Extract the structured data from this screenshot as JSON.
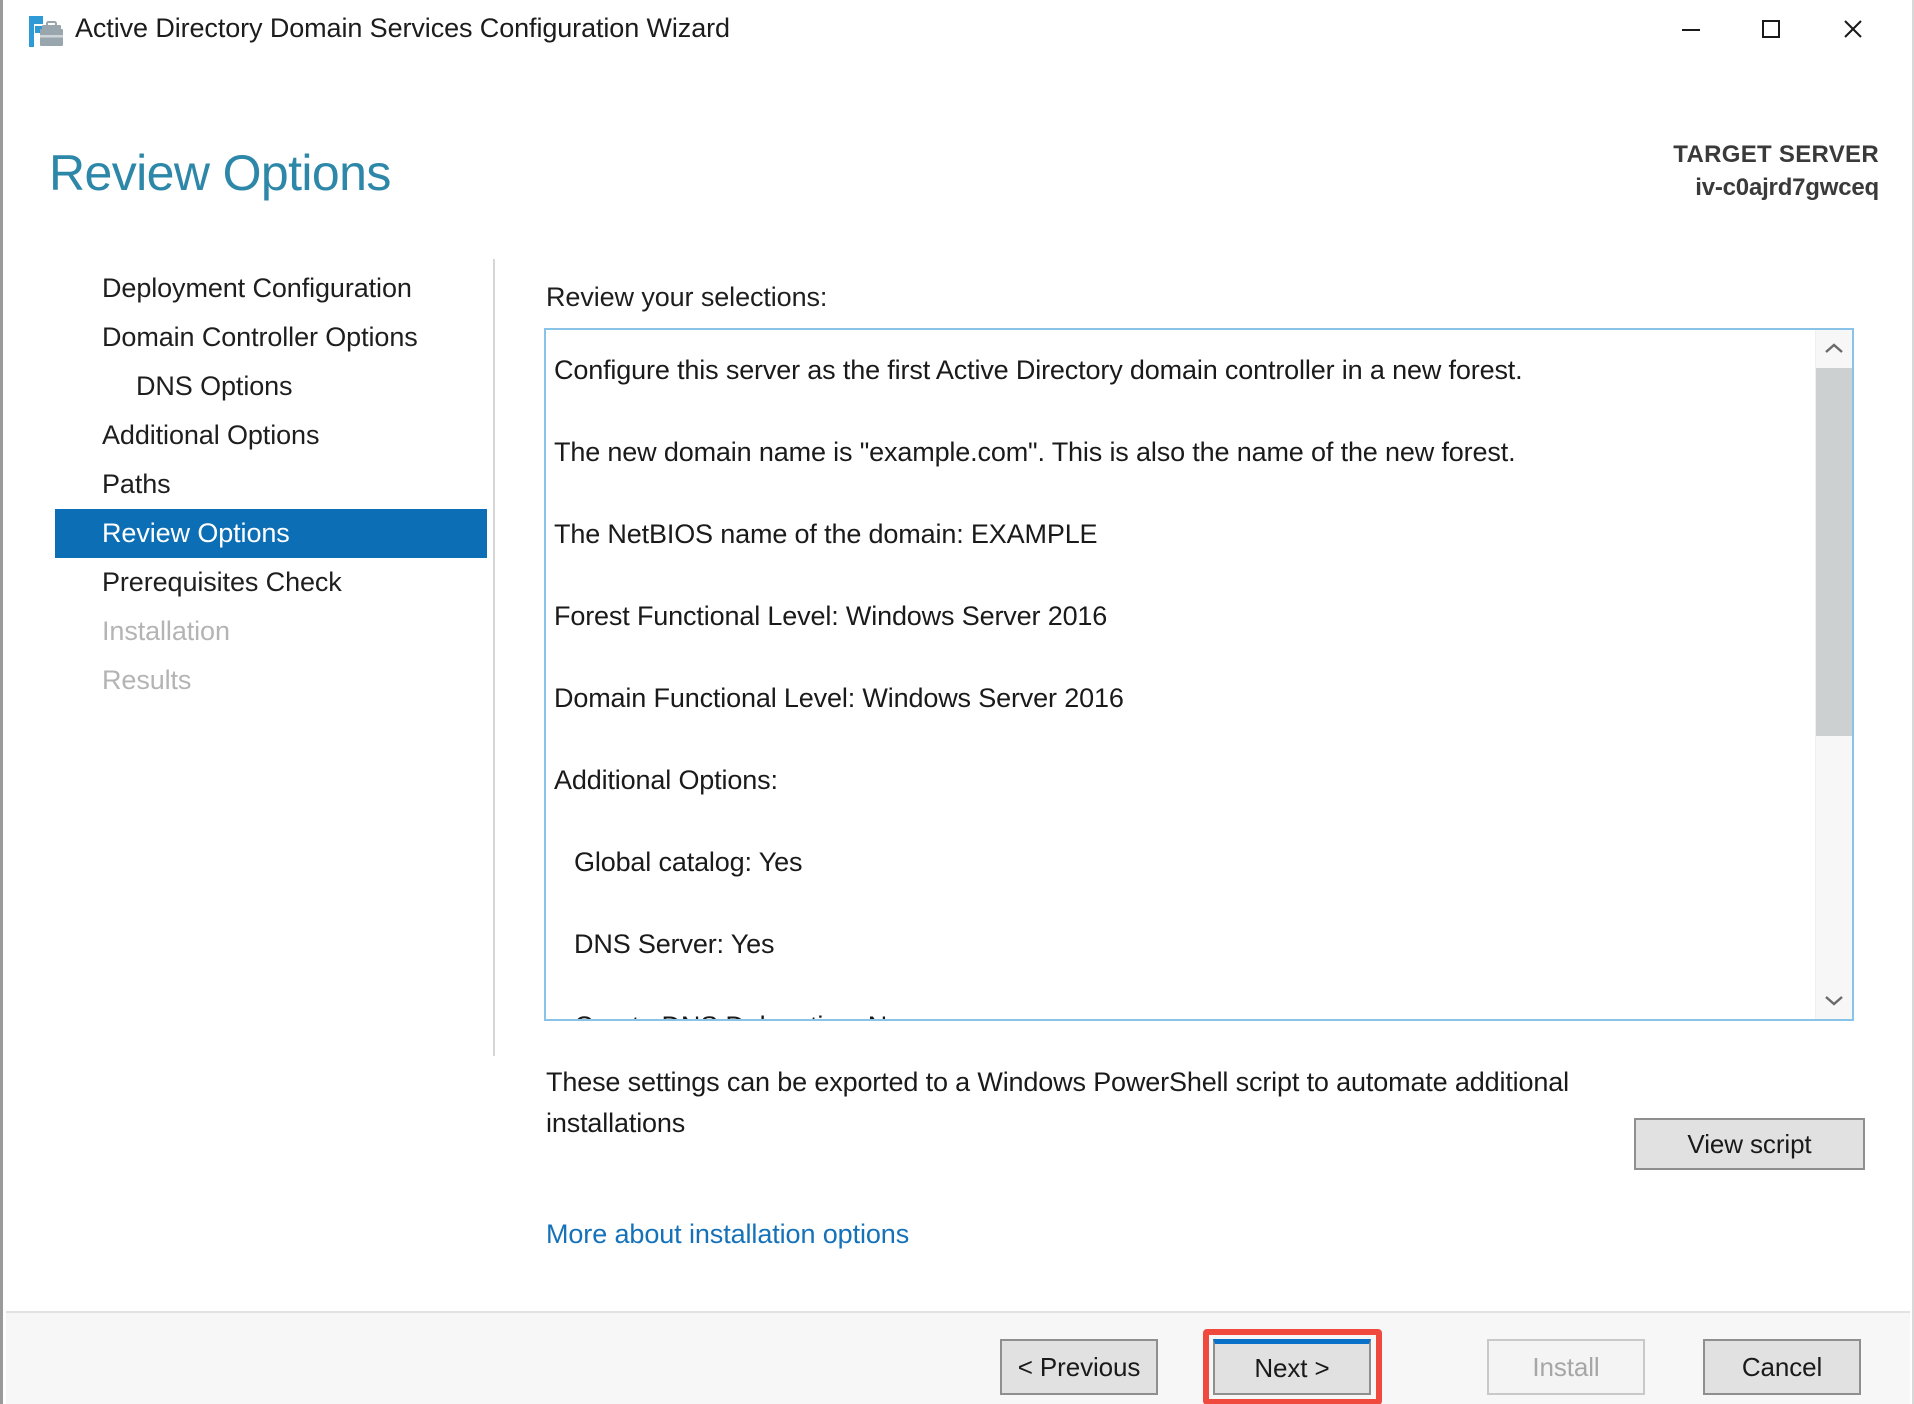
{
  "window": {
    "title": "Active Directory Domain Services Configuration Wizard",
    "icon": "ad-ds-wizard-icon",
    "controls": {
      "minimize": "—",
      "maximize": "□",
      "close": "✕"
    }
  },
  "header": {
    "page_title": "Review Options",
    "target_server_label": "TARGET SERVER",
    "target_server_name": "iv-c0ajrd7gwceq",
    "accent_color": "#2d87a8"
  },
  "sidebar": {
    "selected_index": 5,
    "selected_color": "#0c6eb4",
    "items": [
      {
        "label": "Deployment Configuration",
        "state": "enabled",
        "indent": false
      },
      {
        "label": "Domain Controller Options",
        "state": "enabled",
        "indent": false
      },
      {
        "label": "DNS Options",
        "state": "enabled",
        "indent": true
      },
      {
        "label": "Additional Options",
        "state": "enabled",
        "indent": false
      },
      {
        "label": "Paths",
        "state": "enabled",
        "indent": false
      },
      {
        "label": "Review Options",
        "state": "selected",
        "indent": false
      },
      {
        "label": "Prerequisites Check",
        "state": "enabled",
        "indent": false
      },
      {
        "label": "Installation",
        "state": "disabled",
        "indent": false
      },
      {
        "label": "Results",
        "state": "disabled",
        "indent": false
      }
    ]
  },
  "main": {
    "review_label": "Review your selections:",
    "selections": [
      {
        "text": "Configure this server as the first Active Directory domain controller in a new forest.",
        "sub": false
      },
      {
        "text": "The new domain name is \"example.com\". This is also the name of the new forest.",
        "sub": false
      },
      {
        "text": "The NetBIOS name of the domain: EXAMPLE",
        "sub": false
      },
      {
        "text": "Forest Functional Level: Windows Server 2016",
        "sub": false
      },
      {
        "text": "Domain Functional Level: Windows Server 2016",
        "sub": false
      },
      {
        "text": "Additional Options:",
        "sub": false
      },
      {
        "text": "Global catalog: Yes",
        "sub": true
      },
      {
        "text": "DNS Server: Yes",
        "sub": true
      },
      {
        "text": "Create DNS Delegation: No",
        "sub": true
      }
    ],
    "scrollbar": {
      "up_arrow": "scroll-up-icon",
      "down_arrow": "scroll-down-icon",
      "thumb_color": "#cdd0d0"
    },
    "export_text": "These settings can be exported to a Windows PowerShell script to automate additional installations",
    "view_script_label": "View script",
    "more_link_label": "More about installation options",
    "link_color": "#1571b8"
  },
  "footer": {
    "previous_label": "< Previous",
    "next_label": "Next >",
    "install_label": "Install",
    "cancel_label": "Cancel",
    "install_disabled": true,
    "next_highlight_color": "#f04a3f"
  }
}
